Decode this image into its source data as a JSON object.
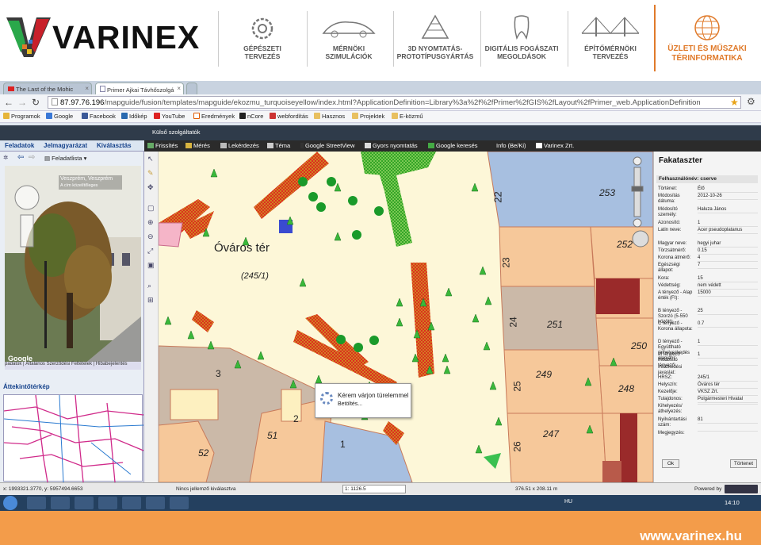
{
  "brand": {
    "name": "VARINEX",
    "website": "www.varinex.hu",
    "accent": "#e07a2a"
  },
  "categories": [
    {
      "label": "GÉPÉSZETI\nTERVEZÉS",
      "icon": "gear-icon"
    },
    {
      "label": "MÉRNÖKI\nSZIMULÁCIÓK",
      "icon": "car-icon"
    },
    {
      "label": "3D NYOMTATÁS-\nPROTOTÍPUSGYÁRTÁS",
      "icon": "pyramid-icon"
    },
    {
      "label": "DIGITÁLIS FOGÁSZATI\nMEGOLDÁSOK",
      "icon": "tooth-icon"
    },
    {
      "label": "ÉPÍTŐMÉRNÖKI\nTERVEZÉS",
      "icon": "bridge-icon"
    },
    {
      "label": "ÜZLETI ÉS MŰSZAKI\nTÉRINFORMATIKA",
      "icon": "globe-icon"
    }
  ],
  "browser": {
    "tabs": [
      {
        "title": "The Last of the Mohic"
      },
      {
        "title": "Primer Ajkai Távhőszolgá"
      }
    ],
    "address_host": "87.97.76.196",
    "address_path": "/mapguide/fusion/templates/mapguide/ekozmu_turquoiseyellow/index.html?ApplicationDefinition=Library%3a%2f%2fPrimer%2fGIS%2fLayout%2fPrimer_web.ApplicationDefinition",
    "bookmarks": [
      "Programok",
      "Google",
      "Facebook",
      "Időkép",
      "YouTube",
      "Eredmények",
      "nCore",
      "webfordítás",
      "Hasznos",
      "Projektek",
      "E-közmű"
    ]
  },
  "app": {
    "top_title": "Külső szolgáltatók",
    "panel_tabs": [
      "Feladatok",
      "Jelmagyarázat",
      "Kiválasztás"
    ],
    "task_list_label": "Feladatlista",
    "toolbar": [
      "Frissítés",
      "Mérés",
      "Lekérdezés",
      "Téma",
      "Google StreetView",
      "Gyors nyomtatás",
      "Google keresés",
      "Info (Be/Ki)",
      "Varinex Zrt."
    ],
    "streetview": {
      "place_title": "Veszprém, Veszprém",
      "place_subtitle": "A cím közelítőleges",
      "caption": "padatok | Általános Szerződési Feltételek | Hibabejelentés",
      "google_mark": "Google"
    },
    "overview_title": "Áttekintőtérkép",
    "map": {
      "square_name": "Óváros tér",
      "square_code": "(245/1)",
      "wait_title": "Kérem várjon türelemmel",
      "wait_sub": "Betöltés...",
      "parcels": [
        "22",
        "253",
        "252",
        "23",
        "251",
        "24",
        "250",
        "249",
        "25",
        "248",
        "247",
        "26",
        "3",
        "2",
        "51",
        "52",
        "1"
      ]
    },
    "info_panel": {
      "title": "Fakataszter",
      "subtitle": "Felhasználónév: cserve",
      "rows": [
        {
          "k": "Történet:",
          "v": "Élő"
        },
        {
          "k": "Módosítás dátuma:",
          "v": "2012-10-26"
        },
        {
          "k": "Módosító személy:",
          "v": "Haluza János"
        },
        {
          "k": "Azonosító:",
          "v": "1"
        },
        {
          "k": "Latin neve:",
          "v": "Acer pseudoplatanus"
        },
        {
          "k": "Magyar neve:",
          "v": "hegyi juhar"
        },
        {
          "k": "Törzsátmérő:",
          "v": "0.15"
        },
        {
          "k": "Korona átmérő:",
          "v": "4"
        },
        {
          "k": "Egészségi állapot:",
          "v": "7"
        },
        {
          "k": "Kora:",
          "v": "15"
        },
        {
          "k": "Védettség:",
          "v": "nem védett"
        },
        {
          "k": "A tényező - Alap érték (Ft):",
          "v": "15000"
        },
        {
          "k": "B tényező - Szorzó (5-550 között):",
          "v": "25"
        },
        {
          "k": "C tényező - Korona állapota:",
          "v": "0.7"
        },
        {
          "k": "D tényező - Együttható (elhelyezkedés alapján):",
          "v": "1"
        },
        {
          "k": "M tényező - Módosító tényező:",
          "v": "1"
        },
        {
          "k": "Intézkedési javaslat:",
          "v": ""
        },
        {
          "k": "HRSZ:",
          "v": "245/1"
        },
        {
          "k": "Helyszín:",
          "v": "Óváros tér"
        },
        {
          "k": "Kezelője:",
          "v": "VKSZ Zrt."
        },
        {
          "k": "Tulajdonos:",
          "v": "Polgármesteri Hivatal"
        },
        {
          "k": "Kihelyezés/áthelyezés:",
          "v": ""
        },
        {
          "k": "Nyilvántartási szám:",
          "v": "81"
        },
        {
          "k": "Megjegyzés:",
          "v": ""
        }
      ],
      "ok_label": "Ok",
      "delete_label": "Törtenet"
    },
    "status": {
      "coords": "x: 1993321.3770, y: 5957494.6653",
      "selection": "Nincs jellemző kiválasztva",
      "scale": "1: 1126.5",
      "size": "376.51 x 208.11 m",
      "powered": "Powered by"
    }
  },
  "taskbar": {
    "lang": "HU",
    "time": "14:10"
  }
}
